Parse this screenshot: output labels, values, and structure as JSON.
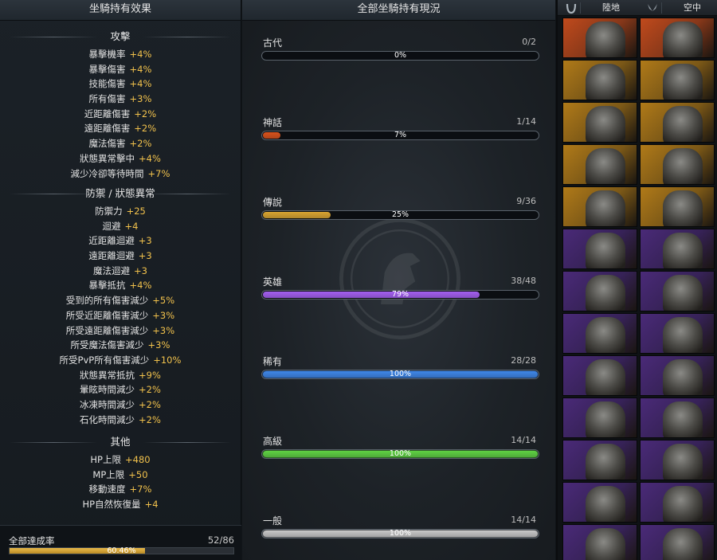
{
  "left_panel": {
    "title": "坐騎持有效果",
    "sections": [
      {
        "title": "攻擊",
        "stats": [
          {
            "name": "暴擊機率",
            "value": "+4%"
          },
          {
            "name": "暴擊傷害",
            "value": "+4%"
          },
          {
            "name": "技能傷害",
            "value": "+4%"
          },
          {
            "name": "所有傷害",
            "value": "+3%"
          },
          {
            "name": "近距離傷害",
            "value": "+2%"
          },
          {
            "name": "遠距離傷害",
            "value": "+2%"
          },
          {
            "name": "魔法傷害",
            "value": "+2%"
          },
          {
            "name": "狀態異常擊中",
            "value": "+4%"
          },
          {
            "name": "減少冷卻等待時間",
            "value": "+7%"
          }
        ]
      },
      {
        "title": "防禦 / 狀態異常",
        "stats": [
          {
            "name": "防禦力",
            "value": "+25"
          },
          {
            "name": "迴避",
            "value": "+4"
          },
          {
            "name": "近距離迴避",
            "value": "+3"
          },
          {
            "name": "遠距離迴避",
            "value": "+3"
          },
          {
            "name": "魔法迴避",
            "value": "+3"
          },
          {
            "name": "暴擊抵抗",
            "value": "+4%"
          },
          {
            "name": "受到的所有傷害減少",
            "value": "+5%"
          },
          {
            "name": "所受近距離傷害減少",
            "value": "+3%"
          },
          {
            "name": "所受遠距離傷害減少",
            "value": "+3%"
          },
          {
            "name": "所受魔法傷害減少",
            "value": "+3%"
          },
          {
            "name": "所受PvP所有傷害減少",
            "value": "+10%"
          },
          {
            "name": "狀態異常抵抗",
            "value": "+9%"
          },
          {
            "name": "暈眩時間減少",
            "value": "+2%"
          },
          {
            "name": "冰凍時間減少",
            "value": "+2%"
          },
          {
            "name": "石化時間減少",
            "value": "+2%"
          }
        ]
      },
      {
        "title": "其他",
        "stats": [
          {
            "name": "HP上限",
            "value": "+480"
          },
          {
            "name": "MP上限",
            "value": "+50"
          },
          {
            "name": "移動速度",
            "value": "+7%"
          },
          {
            "name": "HP自然恢復量",
            "value": "+4"
          }
        ]
      }
    ],
    "total": {
      "label": "全部達成率",
      "count": "52/86",
      "percent_text": "60.46%",
      "progress": 0.6046
    }
  },
  "middle_panel": {
    "title": "全部坐騎持有現況",
    "rarities": [
      {
        "name": "古代",
        "count": "0/2",
        "percent_text": "0%",
        "progress": 0.0,
        "color": "#6a6a6a"
      },
      {
        "name": "神話",
        "count": "1/14",
        "percent_text": "7%",
        "progress": 0.07,
        "color": "#d8521c"
      },
      {
        "name": "傳說",
        "count": "9/36",
        "percent_text": "25%",
        "progress": 0.25,
        "color": "#d9a431"
      },
      {
        "name": "英雄",
        "count": "38/48",
        "percent_text": "79%",
        "progress": 0.79,
        "color": "#a45ff0"
      },
      {
        "name": "稀有",
        "count": "28/28",
        "percent_text": "100%",
        "progress": 1.0,
        "color": "#3f86e8"
      },
      {
        "name": "高級",
        "count": "14/14",
        "percent_text": "100%",
        "progress": 1.0,
        "color": "#5fd143"
      },
      {
        "name": "一般",
        "count": "14/14",
        "percent_text": "100%",
        "progress": 1.0,
        "color": "#c8c8c8"
      }
    ]
  },
  "right_panel": {
    "tabs": [
      {
        "label": "陸地",
        "icon": "horseshoe-icon"
      },
      {
        "label": "空中",
        "icon": "wings-icon"
      }
    ],
    "mount_tiles": [
      [
        "mythic",
        "mythic"
      ],
      [
        "legendary",
        "legendary"
      ],
      [
        "legendary",
        "legendary"
      ],
      [
        "legendary",
        "legendary"
      ],
      [
        "legendary",
        "legendary"
      ],
      [
        "heroic",
        "heroic"
      ],
      [
        "heroic",
        "heroic"
      ],
      [
        "heroic",
        "heroic"
      ],
      [
        "heroic",
        "heroic"
      ],
      [
        "heroic",
        "heroic"
      ],
      [
        "heroic",
        "heroic"
      ],
      [
        "heroic",
        "heroic"
      ],
      [
        "heroic",
        "heroic"
      ]
    ],
    "tile_colors": {
      "mythic": "#c04a1c",
      "legendary": "#b07a18",
      "heroic": "#4a2a78"
    }
  }
}
